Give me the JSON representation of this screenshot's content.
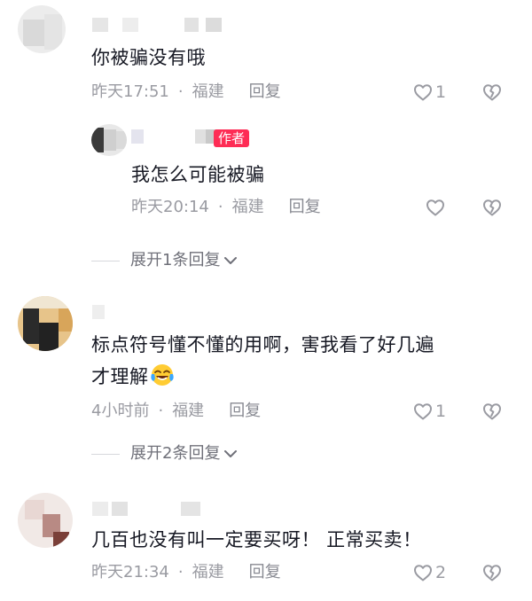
{
  "comments": [
    {
      "text": "你被骗没有哦",
      "time": "昨天17:51",
      "location": "福建",
      "reply_label": "回复",
      "likes": "1",
      "replies": [
        {
          "badge": "作者",
          "text": "我怎么可能被骗",
          "time": "昨天20:14",
          "location": "福建",
          "reply_label": "回复"
        }
      ],
      "expand_label": "展开1条回复"
    },
    {
      "text_line1": "标点符号懂不懂的用啊，害我看了好几遍",
      "text_line2": "才理解",
      "emoji": "laughing-crying-emoji",
      "time": "4小时前",
      "location": "福建",
      "reply_label": "回复",
      "likes": "1",
      "expand_label": "展开2条回复"
    },
    {
      "text": "几百也没有叫一定要买呀！ 正常买卖！",
      "time": "昨天21:34",
      "location": "福建",
      "reply_label": "回复",
      "likes": "2"
    }
  ],
  "separator": "·",
  "colors": {
    "badge": "#fe2c55",
    "meta": "#9a9ba2",
    "text": "#161823"
  },
  "icons": {
    "like": "heart-outline-icon",
    "dislike": "broken-heart-outline-icon",
    "expand": "chevron-down-icon"
  }
}
